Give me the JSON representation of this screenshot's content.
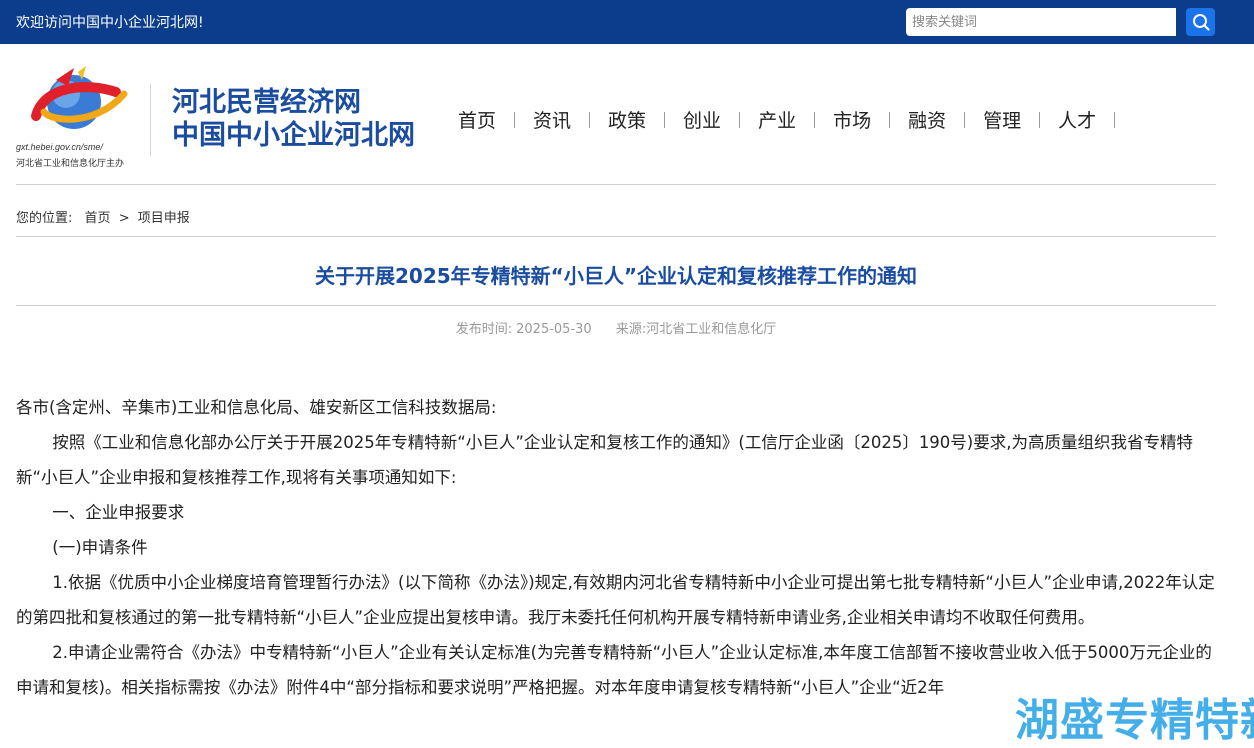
{
  "topbar": {
    "welcome": "欢迎访问中国中小企业河北网!",
    "search_placeholder": "搜索关键词"
  },
  "logo": {
    "url": "gxt.hebei.gov.cn/sme/",
    "sponsor": "河北省工业和信息化厅主办"
  },
  "brand": {
    "line1": "河北民营经济网",
    "line2": "中国中小企业河北网"
  },
  "nav": [
    "首页",
    "资讯",
    "政策",
    "创业",
    "产业",
    "市场",
    "融资",
    "管理",
    "人才"
  ],
  "breadcrumb": {
    "label": "您的位置:",
    "home": "首页",
    "sep": ">",
    "current": "项目申报"
  },
  "article": {
    "title": "关于开展2025年专精特新“小巨人”企业认定和复核推荐工作的通知",
    "publish_label": "发布时间:",
    "publish_date": "2025-05-30",
    "source_label": "来源:",
    "source": "河北省工业和信息化厅",
    "paragraphs": [
      "各市(含定州、辛集市)工业和信息化局、雄安新区工信科技数据局:",
      "按照《工业和信息化部办公厅关于开展2025年专精特新“小巨人”企业认定和复核工作的通知》(工信厅企业函〔2025〕190号)要求,为高质量组织我省专精特新“小巨人”企业申报和复核推荐工作,现将有关事项通知如下:",
      "一、企业申报要求",
      "(一)申请条件",
      "1.依据《优质中小企业梯度培育管理暂行办法》(以下简称《办法》)规定,有效期内河北省专精特新中小企业可提出第七批专精特新“小巨人”企业申请,2022年认定的第四批和复核通过的第一批专精特新“小巨人”企业应提出复核申请。我厅未委托任何机构开展专精特新申请业务,企业相关申请均不收取任何费用。",
      "2.申请企业需符合《办法》中专精特新“小巨人”企业有关认定标准(为完善专精特新“小巨人”企业认定标准,本年度工信部暂不接收营业收入低于5000万元企业的申请和复核)。相关指标需按《办法》附件4中“部分指标和要求说明”严格把握。对本年度申请复核专精特新“小巨人”企业“近2年"
    ]
  },
  "watermark": "湖盛专精特新",
  "colors": {
    "topbar": "#0b3d8c",
    "brand_blue": "#1a4da0",
    "search_button": "#1a73e8",
    "watermark": "#35a8e8"
  }
}
